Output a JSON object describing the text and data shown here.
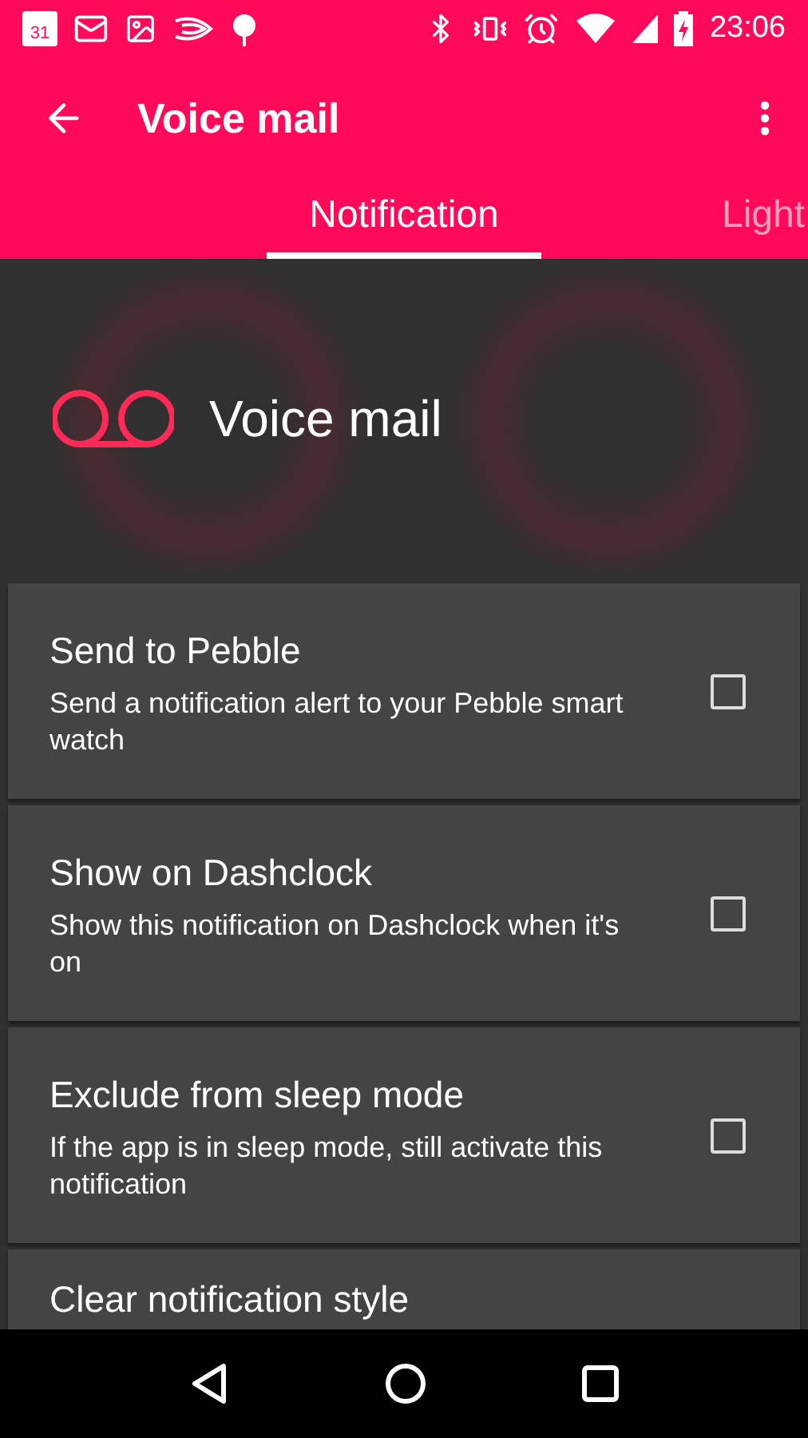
{
  "status_bar": {
    "calendar_day": "31",
    "time": "23:06"
  },
  "app_bar": {
    "title": "Voice mail"
  },
  "tabs": [
    {
      "label": "Notification",
      "selected": true
    },
    {
      "label": "Light",
      "selected": false
    }
  ],
  "header": {
    "title": "Voice mail"
  },
  "settings": [
    {
      "title": "Send to Pebble",
      "description": "Send a notification alert to your Pebble smart watch",
      "checked": false
    },
    {
      "title": "Show on Dashclock",
      "description": "Show this notification on Dashclock when it's on",
      "checked": false
    },
    {
      "title": "Exclude from sleep mode",
      "description": "If the app is in sleep mode, still activate this notification",
      "checked": false
    },
    {
      "title": "Clear notification style"
    }
  ]
}
